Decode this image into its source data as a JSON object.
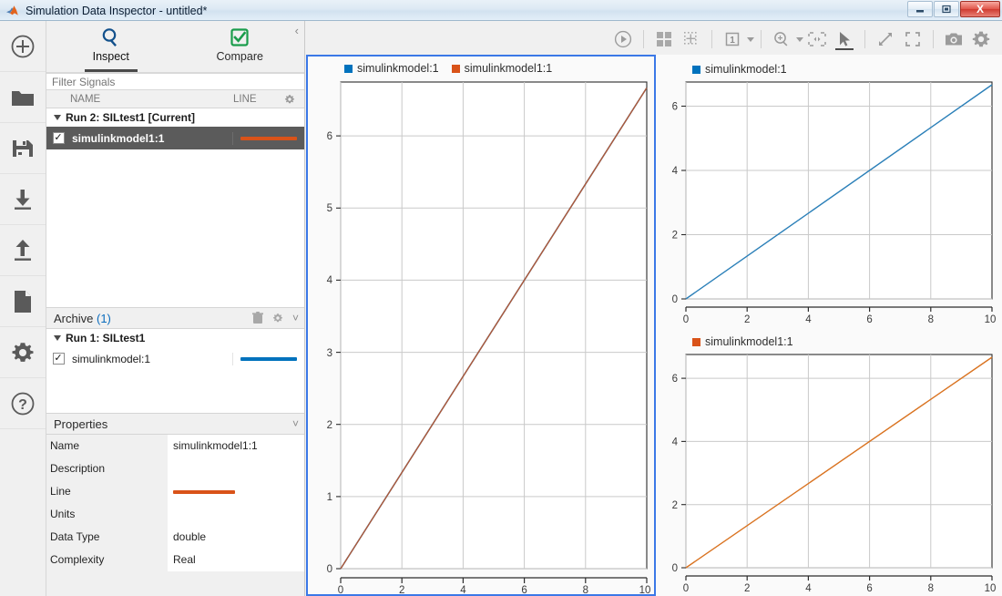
{
  "window": {
    "title": "Simulation Data Inspector - untitled*",
    "ghost_suffix": " ",
    "minimize_label": "Minimize",
    "maximize_label": "Restore",
    "close_label": "X"
  },
  "rail": {
    "items": [
      {
        "icon": "add-circle-icon",
        "label": "Add"
      },
      {
        "icon": "open-folder-icon",
        "label": "Open"
      },
      {
        "icon": "save-icon",
        "label": "Save"
      },
      {
        "icon": "import-icon",
        "label": "Import"
      },
      {
        "icon": "export-icon",
        "label": "Export"
      },
      {
        "icon": "report-icon",
        "label": "Report"
      },
      {
        "icon": "gear-icon",
        "label": "Preferences"
      },
      {
        "icon": "help-icon",
        "label": "Help"
      }
    ]
  },
  "left_panel": {
    "tabs": [
      {
        "label": "Inspect",
        "icon": "search-icon",
        "active": true
      },
      {
        "label": "Compare",
        "icon": "check-square-icon",
        "active": false
      }
    ],
    "collapse_icon": "chevron-left-icon",
    "filter": {
      "placeholder": "Filter Signals",
      "value": ""
    },
    "columns": {
      "name": "NAME",
      "line": "LINE",
      "settings_icon": "gear-icon"
    },
    "runs": [
      {
        "label": "Run 2: SILtest1 [Current]",
        "expanded": true,
        "signals": [
          {
            "name": "simulinkmodel1:1",
            "checked": true,
            "color": "#d95319",
            "selected": true
          }
        ]
      }
    ],
    "archive": {
      "title": "Archive",
      "count": "(1)",
      "delete_icon": "trash-icon",
      "settings_icon": "gear-icon",
      "collapse_icon": "chevron-down-icon",
      "runs": [
        {
          "label": "Run 1: SILtest1",
          "expanded": true,
          "signals": [
            {
              "name": "simulinkmodel:1",
              "checked": true,
              "color": "#0072bd",
              "selected": false
            }
          ]
        }
      ]
    },
    "properties": {
      "title": "Properties",
      "collapse_icon": "chevron-down-icon",
      "rows": [
        {
          "key": "Name",
          "value": "simulinkmodel1:1",
          "type": "text"
        },
        {
          "key": "Description",
          "value": "",
          "type": "text"
        },
        {
          "key": "Line",
          "value": "",
          "type": "color",
          "color": "#d95319"
        },
        {
          "key": "Units",
          "value": "",
          "type": "text"
        },
        {
          "key": "Data Type",
          "value": "double",
          "type": "text"
        },
        {
          "key": "Complexity",
          "value": "Real",
          "type": "text"
        }
      ]
    }
  },
  "toolbar": {
    "items": [
      {
        "icon": "play-circle-icon",
        "name": "run-button",
        "label": "Run"
      },
      {
        "icon": "layout-grid-icon",
        "name": "subplot-layout-button",
        "label": "Subplot Layout"
      },
      {
        "icon": "snap-grid-icon",
        "name": "grid-spacing-button",
        "label": "Grid"
      },
      {
        "icon": "subplot-number-icon",
        "name": "subplot-index-button",
        "label": "1"
      },
      {
        "icon": "zoom-in-icon",
        "name": "zoom-button",
        "label": "Zoom In"
      },
      {
        "icon": "pan-icon",
        "name": "pan-button",
        "label": "Pan"
      },
      {
        "icon": "cursor-arrow-icon",
        "name": "select-cursor-button",
        "label": "Select",
        "active": true
      },
      {
        "icon": "expand-arrows-icon",
        "name": "fit-to-view-button",
        "label": "Fit to View"
      },
      {
        "icon": "fullscreen-icon",
        "name": "maximize-plot-button",
        "label": "Full Screen"
      },
      {
        "icon": "camera-icon",
        "name": "snapshot-button",
        "label": "Snapshot"
      },
      {
        "icon": "gear-icon",
        "name": "plot-settings-button",
        "label": "Settings"
      }
    ],
    "subplot_index": "1"
  },
  "chart_data": [
    {
      "id": "main-plot",
      "type": "line",
      "selected": true,
      "title": "",
      "xlabel": "",
      "ylabel": "",
      "xlim": [
        0,
        10
      ],
      "ylim": [
        0,
        6.75
      ],
      "xticks": [
        0,
        2,
        4,
        6,
        8,
        10
      ],
      "yticks": [
        0,
        1,
        2,
        3,
        4,
        5,
        6
      ],
      "grid": true,
      "legend_position": "top-left",
      "series": [
        {
          "name": "simulinkmodel:1",
          "color": "#0072bd",
          "x": [
            0,
            1,
            2,
            3,
            4,
            5,
            6,
            7,
            8,
            9,
            10
          ],
          "values": [
            0,
            0.67,
            1.34,
            2.0,
            2.67,
            3.34,
            4.0,
            4.67,
            5.34,
            6.0,
            6.67
          ]
        },
        {
          "name": "simulinkmodel1:1",
          "color": "#d95319",
          "x": [
            0,
            1,
            2,
            3,
            4,
            5,
            6,
            7,
            8,
            9,
            10
          ],
          "values": [
            0,
            0.67,
            1.34,
            2.0,
            2.67,
            3.34,
            4.0,
            4.67,
            5.34,
            6.0,
            6.67
          ]
        }
      ]
    },
    {
      "id": "top-right-plot",
      "type": "line",
      "selected": false,
      "title": "",
      "xlabel": "",
      "ylabel": "",
      "xlim": [
        0,
        10
      ],
      "ylim": [
        0,
        6.75
      ],
      "xticks": [
        0,
        2,
        4,
        6,
        8,
        10
      ],
      "yticks": [
        0,
        2,
        4,
        6
      ],
      "grid": true,
      "legend_position": "top-left",
      "series": [
        {
          "name": "simulinkmodel:1",
          "color": "#0072bd",
          "x": [
            0,
            1,
            2,
            3,
            4,
            5,
            6,
            7,
            8,
            9,
            10
          ],
          "values": [
            0,
            0.67,
            1.34,
            2.0,
            2.67,
            3.34,
            4.0,
            4.67,
            5.34,
            6.0,
            6.67
          ]
        }
      ]
    },
    {
      "id": "bottom-right-plot",
      "type": "line",
      "selected": false,
      "title": "",
      "xlabel": "",
      "ylabel": "",
      "xlim": [
        0,
        10
      ],
      "ylim": [
        0,
        6.75
      ],
      "xticks": [
        0,
        2,
        4,
        6,
        8,
        10
      ],
      "yticks": [
        0,
        2,
        4,
        6
      ],
      "grid": true,
      "legend_position": "top-left",
      "series": [
        {
          "name": "simulinkmodel1:1",
          "color": "#d95319",
          "x": [
            0,
            1,
            2,
            3,
            4,
            5,
            6,
            7,
            8,
            9,
            10
          ],
          "values": [
            0,
            0.67,
            1.34,
            2.0,
            2.67,
            3.34,
            4.0,
            4.67,
            5.34,
            6.0,
            6.67
          ]
        }
      ]
    }
  ],
  "colors": {
    "series_blue": "#0072bd",
    "series_orange": "#d95319",
    "selection_border": "#3b78e7",
    "selected_row": "#5b5b5b",
    "accent_link": "#0a6cbd"
  }
}
